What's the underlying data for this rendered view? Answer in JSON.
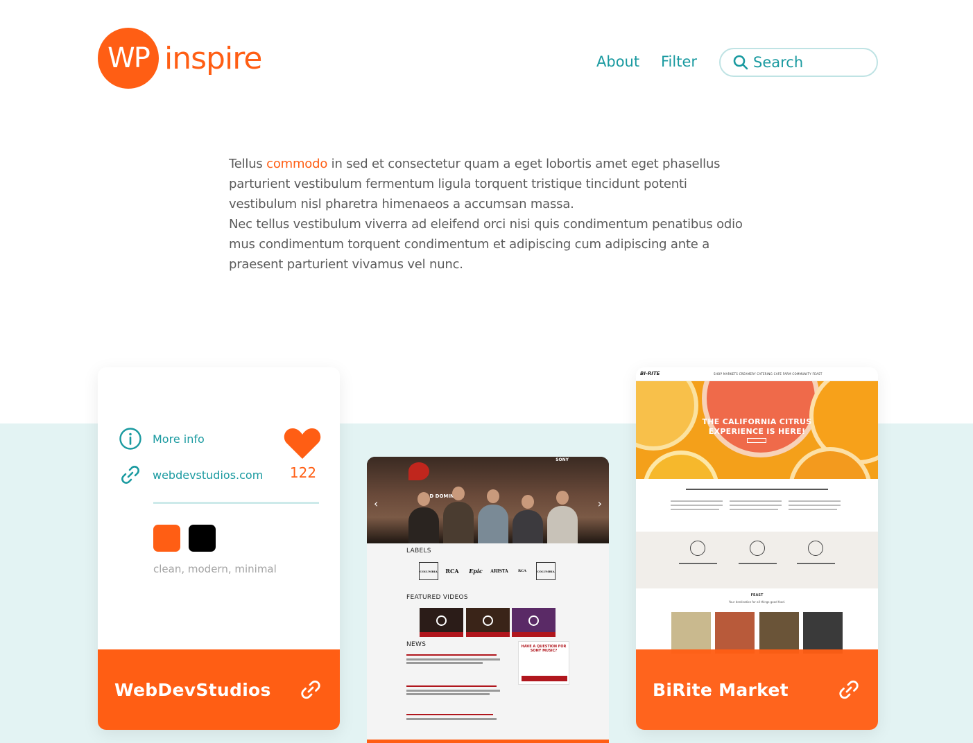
{
  "header": {
    "logo_mark": "WP",
    "logo_word": "inspire",
    "nav": {
      "about": "About",
      "filter": "Filter"
    },
    "search_placeholder": "Search"
  },
  "intro": {
    "prefix": "Tellus ",
    "highlight": "commodo",
    "line1_rest": " in sed et consectetur quam a eget lobortis amet eget phasellus parturient vestibulum fermentum ligula torquent tristique tincidunt potenti vestibulum nisl pharetra himenaeos a accumsan massa.",
    "paragraph2": "Nec tellus vestibulum viverra ad eleifend orci nisi quis condimentum penatibus odio mus condimentum torquent condimentum et adipiscing cum adipiscing ante a praesent parturient vivamus vel nunc."
  },
  "cards": [
    {
      "title": "WebDevStudios",
      "more_info": "More info",
      "url": "webdevstudios.com",
      "likes": "122",
      "swatches": [
        "#ff5e14",
        "#000000"
      ],
      "tags": "clean, modern, minimal"
    },
    {
      "preview": "sony-music",
      "headings": {
        "labels": "LABELS",
        "videos": "FEATURED VIDEOS",
        "news": "NEWS"
      },
      "hero_caption": "OLD DOMINION",
      "question": "HAVE A QUESTION FOR SONY MUSIC?",
      "label_logos": [
        "COLUMBIA",
        "RCA",
        "Epic",
        "ARISTA",
        "RCA",
        "COLUMBIA"
      ]
    },
    {
      "title": "BiRite Market",
      "preview": "birite",
      "hero_text_1": "THE CALIFORNIA CITRUS",
      "hero_text_2": "EXPERIENCE IS HERE!",
      "brand": "BI-RITE",
      "nav_links": "SHOP   MARKETS   CREAMERY   CATERING   CAFE   FARM   COMMUNITY   FEAST",
      "feast": "FEAST",
      "feast_sub": "Your destination for all things good food."
    }
  ],
  "colors": {
    "accent": "#ff5e14",
    "teal": "#1a9aa0",
    "band": "#e3f3f3"
  }
}
